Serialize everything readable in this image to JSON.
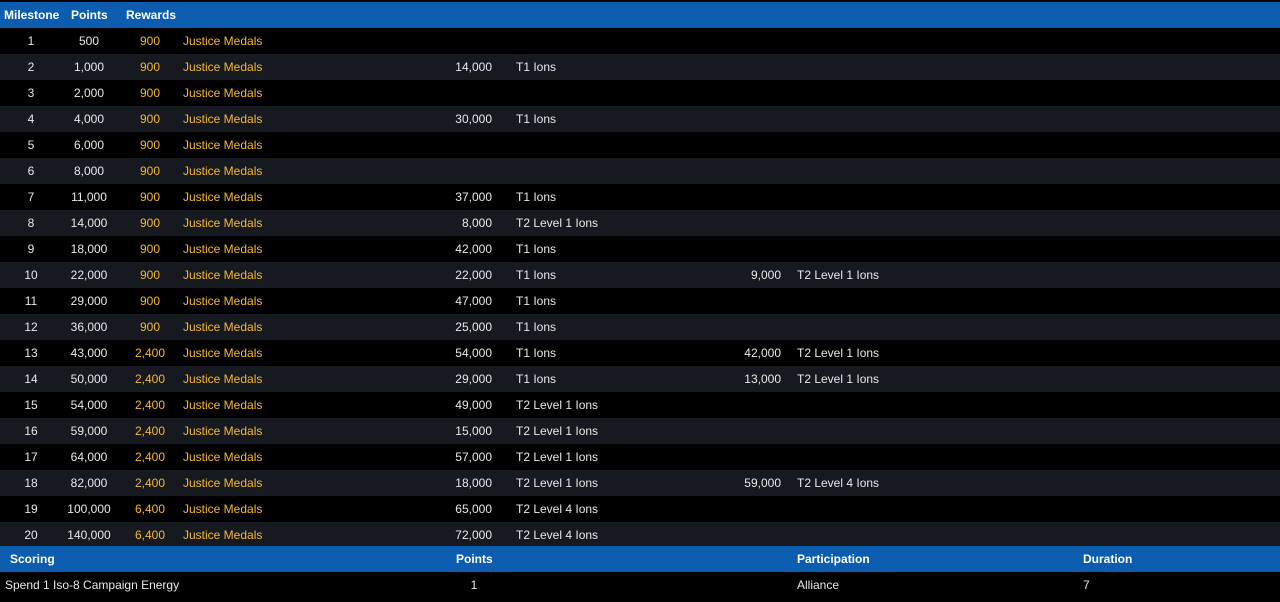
{
  "milestone_table": {
    "headers": {
      "milestone": "Milestone",
      "points": "Points",
      "rewards": "Rewards"
    },
    "rows": [
      {
        "milestone": "1",
        "points": "500",
        "amount": "900",
        "reward": "Justice Medals",
        "r2_amount": "",
        "r2_item": "",
        "r3_amount": "",
        "r3_item": ""
      },
      {
        "milestone": "2",
        "points": "1,000",
        "amount": "900",
        "reward": "Justice Medals",
        "r2_amount": "14,000",
        "r2_item": "T1 Ions",
        "r3_amount": "",
        "r3_item": ""
      },
      {
        "milestone": "3",
        "points": "2,000",
        "amount": "900",
        "reward": "Justice Medals",
        "r2_amount": "",
        "r2_item": "",
        "r3_amount": "",
        "r3_item": ""
      },
      {
        "milestone": "4",
        "points": "4,000",
        "amount": "900",
        "reward": "Justice Medals",
        "r2_amount": "30,000",
        "r2_item": "T1 Ions",
        "r3_amount": "",
        "r3_item": ""
      },
      {
        "milestone": "5",
        "points": "6,000",
        "amount": "900",
        "reward": "Justice Medals",
        "r2_amount": "",
        "r2_item": "",
        "r3_amount": "",
        "r3_item": ""
      },
      {
        "milestone": "6",
        "points": "8,000",
        "amount": "900",
        "reward": "Justice Medals",
        "r2_amount": "",
        "r2_item": "",
        "r3_amount": "",
        "r3_item": ""
      },
      {
        "milestone": "7",
        "points": "11,000",
        "amount": "900",
        "reward": "Justice Medals",
        "r2_amount": "37,000",
        "r2_item": "T1 Ions",
        "r3_amount": "",
        "r3_item": ""
      },
      {
        "milestone": "8",
        "points": "14,000",
        "amount": "900",
        "reward": "Justice Medals",
        "r2_amount": "8,000",
        "r2_item": "T2 Level 1 Ions",
        "r3_amount": "",
        "r3_item": ""
      },
      {
        "milestone": "9",
        "points": "18,000",
        "amount": "900",
        "reward": "Justice Medals",
        "r2_amount": "42,000",
        "r2_item": "T1 Ions",
        "r3_amount": "",
        "r3_item": ""
      },
      {
        "milestone": "10",
        "points": "22,000",
        "amount": "900",
        "reward": "Justice Medals",
        "r2_amount": "22,000",
        "r2_item": "T1 Ions",
        "r3_amount": "9,000",
        "r3_item": "T2 Level 1 Ions"
      },
      {
        "milestone": "11",
        "points": "29,000",
        "amount": "900",
        "reward": "Justice Medals",
        "r2_amount": "47,000",
        "r2_item": "T1 Ions",
        "r3_amount": "",
        "r3_item": ""
      },
      {
        "milestone": "12",
        "points": "36,000",
        "amount": "900",
        "reward": "Justice Medals",
        "r2_amount": "25,000",
        "r2_item": "T1 Ions",
        "r3_amount": "",
        "r3_item": ""
      },
      {
        "milestone": "13",
        "points": "43,000",
        "amount": "2,400",
        "reward": "Justice Medals",
        "r2_amount": "54,000",
        "r2_item": "T1 Ions",
        "r3_amount": "42,000",
        "r3_item": "T2 Level 1 Ions"
      },
      {
        "milestone": "14",
        "points": "50,000",
        "amount": "2,400",
        "reward": "Justice Medals",
        "r2_amount": "29,000",
        "r2_item": "T1 Ions",
        "r3_amount": "13,000",
        "r3_item": "T2 Level 1 Ions"
      },
      {
        "milestone": "15",
        "points": "54,000",
        "amount": "2,400",
        "reward": "Justice Medals",
        "r2_amount": "49,000",
        "r2_item": "T2 Level 1 Ions",
        "r3_amount": "",
        "r3_item": ""
      },
      {
        "milestone": "16",
        "points": "59,000",
        "amount": "2,400",
        "reward": "Justice Medals",
        "r2_amount": "15,000",
        "r2_item": "T2 Level 1 Ions",
        "r3_amount": "",
        "r3_item": ""
      },
      {
        "milestone": "17",
        "points": "64,000",
        "amount": "2,400",
        "reward": "Justice Medals",
        "r2_amount": "57,000",
        "r2_item": "T2 Level 1 Ions",
        "r3_amount": "",
        "r3_item": ""
      },
      {
        "milestone": "18",
        "points": "82,000",
        "amount": "2,400",
        "reward": "Justice Medals",
        "r2_amount": "18,000",
        "r2_item": "T2 Level 1 Ions",
        "r3_amount": "59,000",
        "r3_item": "T2 Level 4 Ions"
      },
      {
        "milestone": "19",
        "points": "100,000",
        "amount": "6,400",
        "reward": "Justice Medals",
        "r2_amount": "65,000",
        "r2_item": "T2 Level 4 Ions",
        "r3_amount": "",
        "r3_item": ""
      },
      {
        "milestone": "20",
        "points": "140,000",
        "amount": "6,400",
        "reward": "Justice Medals",
        "r2_amount": "72,000",
        "r2_item": "T2 Level 4 Ions",
        "r3_amount": "",
        "r3_item": ""
      }
    ]
  },
  "scoring_table": {
    "headers": {
      "scoring": "Scoring",
      "points": "Points",
      "participation": "Participation",
      "duration": "Duration"
    },
    "row": {
      "scoring": "Spend 1 Iso-8 Campaign Energy",
      "points": "1",
      "participation": "Alliance",
      "duration": "7"
    }
  },
  "colors": {
    "header_bg": "#0c5cb0",
    "alt_row_bg": "#16191f",
    "reward_gold": "#f5b82e"
  }
}
